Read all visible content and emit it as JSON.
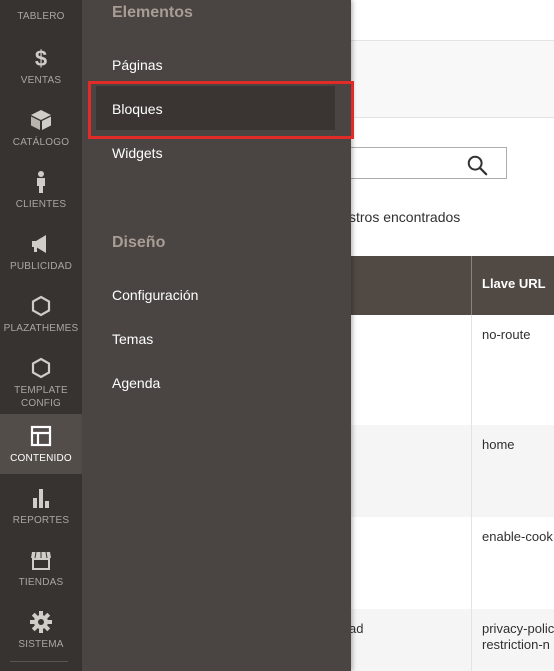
{
  "nav": {
    "items": [
      {
        "label": "TABLERO",
        "icon": "dashboard-icon"
      },
      {
        "label": "VENTAS",
        "icon": "dollar-icon"
      },
      {
        "label": "CATÁLOGO",
        "icon": "box-icon"
      },
      {
        "label": "CLIENTES",
        "icon": "person-icon"
      },
      {
        "label": "PUBLICIDAD",
        "icon": "megaphone-icon"
      },
      {
        "label": "PLAZATHEMES",
        "icon": "hexagon-icon"
      },
      {
        "label": "TEMPLATE CONFIG",
        "icon": "hexagon-icon"
      },
      {
        "label": "CONTENIDO",
        "icon": "layout-icon",
        "active": true
      },
      {
        "label": "REPORTES",
        "icon": "bar-chart-icon"
      },
      {
        "label": "TIENDAS",
        "icon": "store-icon"
      },
      {
        "label": "SISTEMA",
        "icon": "gear-icon"
      }
    ]
  },
  "flyout": {
    "section1": "Elementos",
    "links1": [
      "Páginas",
      "Bloques",
      "Widgets"
    ],
    "section2": "Diseño",
    "links2": [
      "Configuración",
      "Temas",
      "Agenda"
    ],
    "active": "Bloques"
  },
  "main": {
    "records_text": "stros encontrados",
    "column_header": "Llave URL",
    "rows": [
      {
        "url_key": "no-route",
        "extra": ""
      },
      {
        "url_key": "home",
        "extra": ""
      },
      {
        "url_key": "enable-cook",
        "extra": ""
      },
      {
        "url_key": "privacy-polic",
        "url_key_2": "restriction-n",
        "extra": "ad"
      }
    ]
  },
  "colors": {
    "nav_bg": "#373330",
    "flyout_bg": "#4a4542",
    "highlight": "#e02b27",
    "grid_header": "#514943"
  }
}
